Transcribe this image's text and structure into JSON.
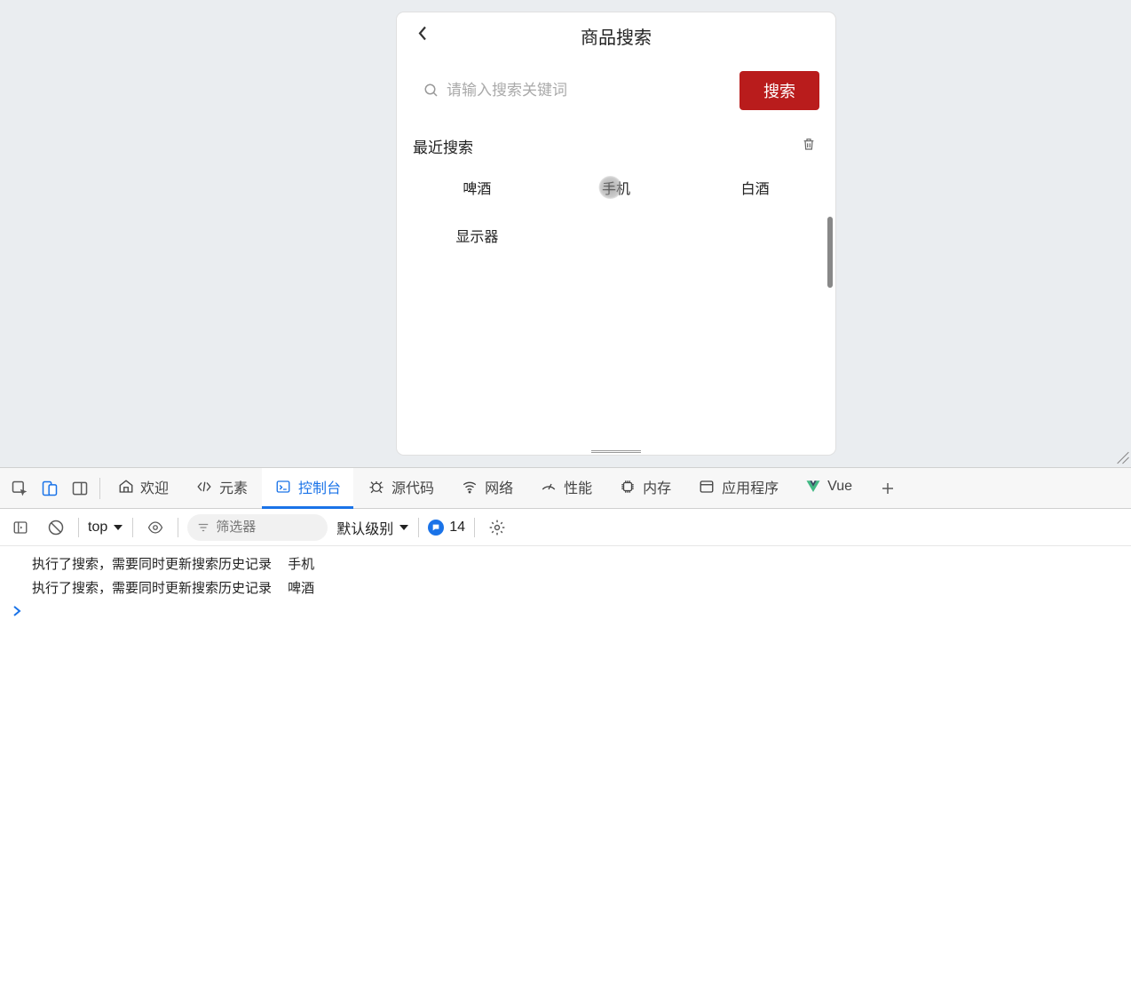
{
  "mobile": {
    "title": "商品搜索",
    "search_placeholder": "请输入搜索关键词",
    "search_button": "搜索",
    "recent_label": "最近搜索",
    "tags": [
      "啤酒",
      "手机",
      "白酒",
      "显示器"
    ]
  },
  "devtools": {
    "tabs": {
      "welcome": "欢迎",
      "elements": "元素",
      "console": "控制台",
      "sources": "源代码",
      "network": "网络",
      "performance": "性能",
      "memory": "内存",
      "application": "应用程序",
      "vue": "Vue"
    },
    "toolbar": {
      "context": "top",
      "filter_placeholder": "筛选器",
      "level": "默认级别",
      "issue_count": "14"
    },
    "console_lines": [
      "执行了搜索，需要同时更新搜索历史记录  手机",
      "执行了搜索，需要同时更新搜索历史记录  啤酒"
    ],
    "prompt": ">"
  }
}
